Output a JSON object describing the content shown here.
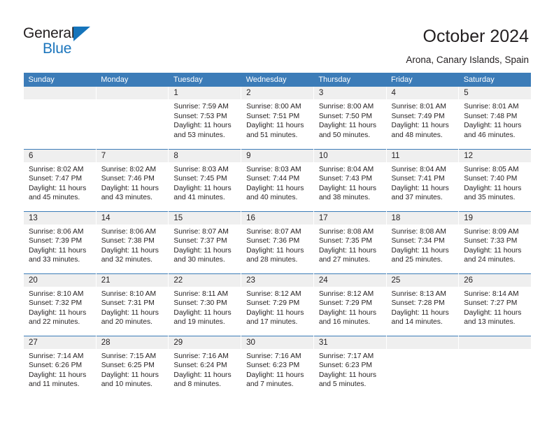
{
  "brand": {
    "name_line1": "General",
    "name_line2": "Blue",
    "accent_color": "#1b75bc",
    "logo_icon": "triangle-icon"
  },
  "header": {
    "title": "October 2024",
    "subtitle": "Arona, Canary Islands, Spain"
  },
  "calendar": {
    "header_bg": "#3c7cb8",
    "daynum_bg": "#efefef",
    "weekday_labels": [
      "Sunday",
      "Monday",
      "Tuesday",
      "Wednesday",
      "Thursday",
      "Friday",
      "Saturday"
    ],
    "labels": {
      "sunrise": "Sunrise:",
      "sunset": "Sunset:",
      "daylight": "Daylight:"
    },
    "weeks": [
      [
        {
          "day": "",
          "empty": true
        },
        {
          "day": "",
          "empty": true
        },
        {
          "day": "1",
          "sunrise": "Sunrise: 7:59 AM",
          "sunset": "Sunset: 7:53 PM",
          "daylight1": "Daylight: 11 hours",
          "daylight2": "and 53 minutes."
        },
        {
          "day": "2",
          "sunrise": "Sunrise: 8:00 AM",
          "sunset": "Sunset: 7:51 PM",
          "daylight1": "Daylight: 11 hours",
          "daylight2": "and 51 minutes."
        },
        {
          "day": "3",
          "sunrise": "Sunrise: 8:00 AM",
          "sunset": "Sunset: 7:50 PM",
          "daylight1": "Daylight: 11 hours",
          "daylight2": "and 50 minutes."
        },
        {
          "day": "4",
          "sunrise": "Sunrise: 8:01 AM",
          "sunset": "Sunset: 7:49 PM",
          "daylight1": "Daylight: 11 hours",
          "daylight2": "and 48 minutes."
        },
        {
          "day": "5",
          "sunrise": "Sunrise: 8:01 AM",
          "sunset": "Sunset: 7:48 PM",
          "daylight1": "Daylight: 11 hours",
          "daylight2": "and 46 minutes."
        }
      ],
      [
        {
          "day": "6",
          "sunrise": "Sunrise: 8:02 AM",
          "sunset": "Sunset: 7:47 PM",
          "daylight1": "Daylight: 11 hours",
          "daylight2": "and 45 minutes."
        },
        {
          "day": "7",
          "sunrise": "Sunrise: 8:02 AM",
          "sunset": "Sunset: 7:46 PM",
          "daylight1": "Daylight: 11 hours",
          "daylight2": "and 43 minutes."
        },
        {
          "day": "8",
          "sunrise": "Sunrise: 8:03 AM",
          "sunset": "Sunset: 7:45 PM",
          "daylight1": "Daylight: 11 hours",
          "daylight2": "and 41 minutes."
        },
        {
          "day": "9",
          "sunrise": "Sunrise: 8:03 AM",
          "sunset": "Sunset: 7:44 PM",
          "daylight1": "Daylight: 11 hours",
          "daylight2": "and 40 minutes."
        },
        {
          "day": "10",
          "sunrise": "Sunrise: 8:04 AM",
          "sunset": "Sunset: 7:43 PM",
          "daylight1": "Daylight: 11 hours",
          "daylight2": "and 38 minutes."
        },
        {
          "day": "11",
          "sunrise": "Sunrise: 8:04 AM",
          "sunset": "Sunset: 7:41 PM",
          "daylight1": "Daylight: 11 hours",
          "daylight2": "and 37 minutes."
        },
        {
          "day": "12",
          "sunrise": "Sunrise: 8:05 AM",
          "sunset": "Sunset: 7:40 PM",
          "daylight1": "Daylight: 11 hours",
          "daylight2": "and 35 minutes."
        }
      ],
      [
        {
          "day": "13",
          "sunrise": "Sunrise: 8:06 AM",
          "sunset": "Sunset: 7:39 PM",
          "daylight1": "Daylight: 11 hours",
          "daylight2": "and 33 minutes."
        },
        {
          "day": "14",
          "sunrise": "Sunrise: 8:06 AM",
          "sunset": "Sunset: 7:38 PM",
          "daylight1": "Daylight: 11 hours",
          "daylight2": "and 32 minutes."
        },
        {
          "day": "15",
          "sunrise": "Sunrise: 8:07 AM",
          "sunset": "Sunset: 7:37 PM",
          "daylight1": "Daylight: 11 hours",
          "daylight2": "and 30 minutes."
        },
        {
          "day": "16",
          "sunrise": "Sunrise: 8:07 AM",
          "sunset": "Sunset: 7:36 PM",
          "daylight1": "Daylight: 11 hours",
          "daylight2": "and 28 minutes."
        },
        {
          "day": "17",
          "sunrise": "Sunrise: 8:08 AM",
          "sunset": "Sunset: 7:35 PM",
          "daylight1": "Daylight: 11 hours",
          "daylight2": "and 27 minutes."
        },
        {
          "day": "18",
          "sunrise": "Sunrise: 8:08 AM",
          "sunset": "Sunset: 7:34 PM",
          "daylight1": "Daylight: 11 hours",
          "daylight2": "and 25 minutes."
        },
        {
          "day": "19",
          "sunrise": "Sunrise: 8:09 AM",
          "sunset": "Sunset: 7:33 PM",
          "daylight1": "Daylight: 11 hours",
          "daylight2": "and 24 minutes."
        }
      ],
      [
        {
          "day": "20",
          "sunrise": "Sunrise: 8:10 AM",
          "sunset": "Sunset: 7:32 PM",
          "daylight1": "Daylight: 11 hours",
          "daylight2": "and 22 minutes."
        },
        {
          "day": "21",
          "sunrise": "Sunrise: 8:10 AM",
          "sunset": "Sunset: 7:31 PM",
          "daylight1": "Daylight: 11 hours",
          "daylight2": "and 20 minutes."
        },
        {
          "day": "22",
          "sunrise": "Sunrise: 8:11 AM",
          "sunset": "Sunset: 7:30 PM",
          "daylight1": "Daylight: 11 hours",
          "daylight2": "and 19 minutes."
        },
        {
          "day": "23",
          "sunrise": "Sunrise: 8:12 AM",
          "sunset": "Sunset: 7:29 PM",
          "daylight1": "Daylight: 11 hours",
          "daylight2": "and 17 minutes."
        },
        {
          "day": "24",
          "sunrise": "Sunrise: 8:12 AM",
          "sunset": "Sunset: 7:29 PM",
          "daylight1": "Daylight: 11 hours",
          "daylight2": "and 16 minutes."
        },
        {
          "day": "25",
          "sunrise": "Sunrise: 8:13 AM",
          "sunset": "Sunset: 7:28 PM",
          "daylight1": "Daylight: 11 hours",
          "daylight2": "and 14 minutes."
        },
        {
          "day": "26",
          "sunrise": "Sunrise: 8:14 AM",
          "sunset": "Sunset: 7:27 PM",
          "daylight1": "Daylight: 11 hours",
          "daylight2": "and 13 minutes."
        }
      ],
      [
        {
          "day": "27",
          "sunrise": "Sunrise: 7:14 AM",
          "sunset": "Sunset: 6:26 PM",
          "daylight1": "Daylight: 11 hours",
          "daylight2": "and 11 minutes."
        },
        {
          "day": "28",
          "sunrise": "Sunrise: 7:15 AM",
          "sunset": "Sunset: 6:25 PM",
          "daylight1": "Daylight: 11 hours",
          "daylight2": "and 10 minutes."
        },
        {
          "day": "29",
          "sunrise": "Sunrise: 7:16 AM",
          "sunset": "Sunset: 6:24 PM",
          "daylight1": "Daylight: 11 hours",
          "daylight2": "and 8 minutes."
        },
        {
          "day": "30",
          "sunrise": "Sunrise: 7:16 AM",
          "sunset": "Sunset: 6:23 PM",
          "daylight1": "Daylight: 11 hours",
          "daylight2": "and 7 minutes."
        },
        {
          "day": "31",
          "sunrise": "Sunrise: 7:17 AM",
          "sunset": "Sunset: 6:23 PM",
          "daylight1": "Daylight: 11 hours",
          "daylight2": "and 5 minutes."
        },
        {
          "day": "",
          "empty": true
        },
        {
          "day": "",
          "empty": true
        }
      ]
    ]
  }
}
